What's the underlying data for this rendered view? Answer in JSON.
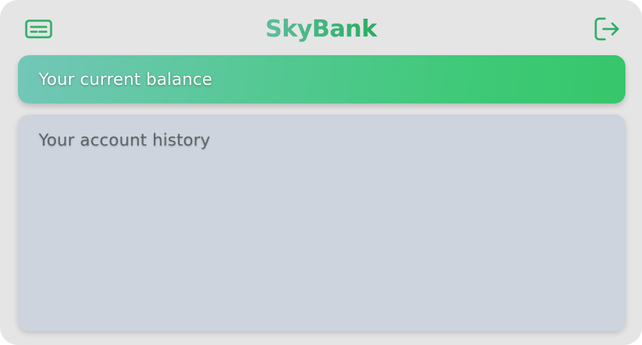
{
  "header": {
    "brand": "SkyBank",
    "left_icon": "account-card-icon",
    "right_icon": "logout-icon"
  },
  "balance": {
    "label": "Your current balance"
  },
  "history": {
    "label": "Your account history"
  },
  "colors": {
    "icon": "#2fae68",
    "brand_start": "#5fbea0",
    "brand_end": "#29ad5f",
    "balance_gradient_start": "#73c7b8",
    "balance_gradient_end": "#36c66a",
    "history_bg": "#cdd4dd",
    "app_bg": "#e5e5e5"
  }
}
